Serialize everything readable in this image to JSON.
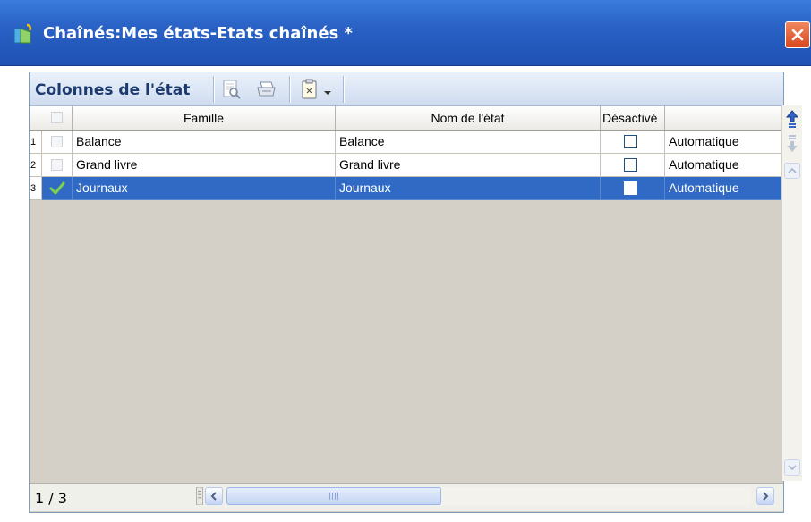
{
  "window": {
    "title": "Chaînés:Mes états-Etats chaînés *",
    "icons": {
      "app": "report-chain-icon",
      "close": "close-icon"
    },
    "close_color": "#e0552a"
  },
  "panel": {
    "title": "Colonnes de l'état",
    "toolbar": [
      {
        "name": "preview-icon"
      },
      {
        "name": "print-icon"
      },
      {
        "name": "clipboard-icon"
      },
      {
        "name": "dropdown-arrow-icon"
      }
    ]
  },
  "grid": {
    "columns": [
      "",
      "Famille",
      "Nom de l'état",
      "Désactivé",
      ""
    ],
    "rows": [
      {
        "num": "1",
        "checked": false,
        "famille": "Balance",
        "nom": "Balance",
        "desactive": false,
        "mode": "Automatique",
        "selected": false
      },
      {
        "num": "2",
        "checked": false,
        "famille": "Grand livre",
        "nom": "Grand livre",
        "desactive": false,
        "mode": "Automatique",
        "selected": false
      },
      {
        "num": "3",
        "checked": true,
        "famille": "Journaux",
        "nom": "Journaux",
        "desactive": false,
        "mode": "Automatique",
        "selected": true
      }
    ],
    "selection_color": "#316ac5"
  },
  "status": {
    "counter": "1 / 3"
  },
  "scrollbar_icons": [
    "move-up-icon",
    "move-down-icon",
    "scroll-up-icon",
    "scroll-down-icon",
    "scroll-left-icon",
    "scroll-right-icon"
  ]
}
